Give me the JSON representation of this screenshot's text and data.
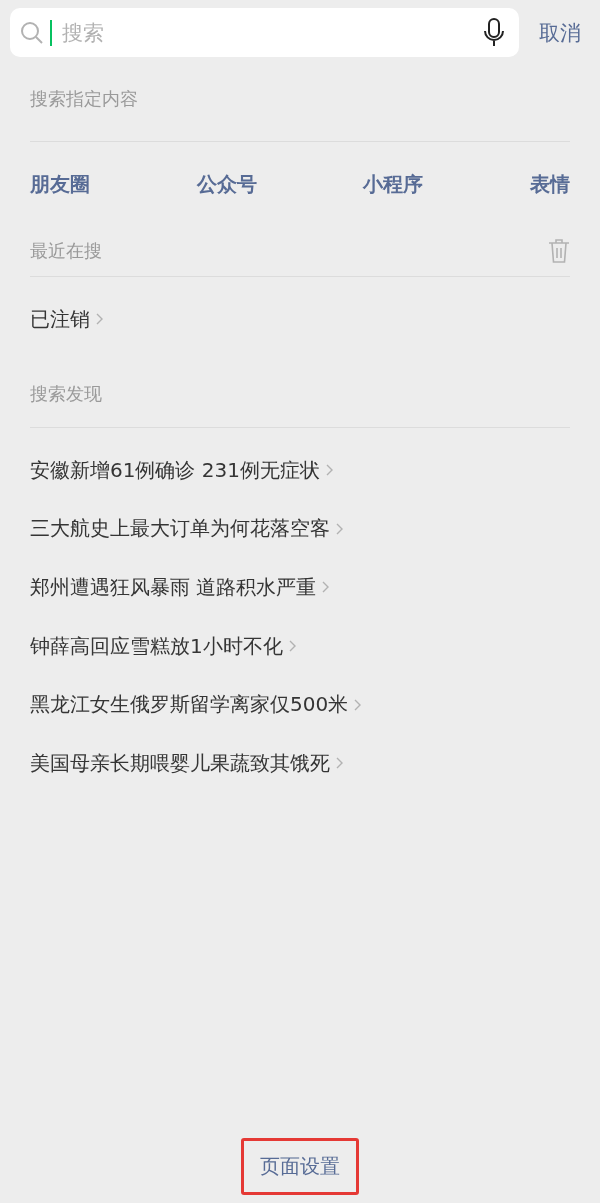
{
  "search": {
    "placeholder": "搜索",
    "focused": true
  },
  "cancel": "取消",
  "scope": {
    "title": "搜索指定内容",
    "items": [
      "朋友圈",
      "公众号",
      "小程序",
      "表情"
    ]
  },
  "recent": {
    "title": "最近在搜",
    "items": [
      "已注销"
    ]
  },
  "discover": {
    "title": "搜索发现",
    "items": [
      "安徽新增61例确诊 231例无症状",
      "三大航史上最大订单为何花落空客",
      "郑州遭遇狂风暴雨 道路积水严重",
      "钟薛高回应雪糕放1小时不化",
      "黑龙江女生俄罗斯留学离家仅500米",
      "美国母亲长期喂婴儿果蔬致其饿死"
    ]
  },
  "footer": {
    "label": "页面设置",
    "highlighted": true
  }
}
